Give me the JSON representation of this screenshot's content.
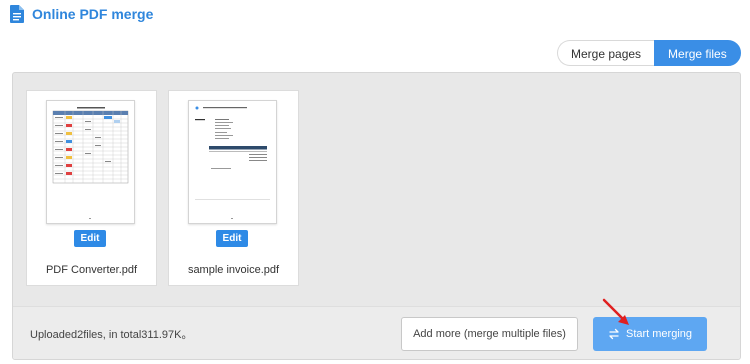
{
  "header": {
    "title": "Online PDF merge",
    "icon": "document-icon"
  },
  "mode_toggle": {
    "merge_pages": "Merge pages",
    "merge_files": "Merge files",
    "active": "merge_files"
  },
  "files": [
    {
      "name": "PDF Converter.pdf",
      "edit_label": "Edit"
    },
    {
      "name": "sample invoice.pdf",
      "edit_label": "Edit"
    }
  ],
  "footer": {
    "upload_info": "Uploaded2files, in total311.97K。",
    "add_more": "Add more (merge multiple files)",
    "start_merging": "Start merging"
  },
  "colors": {
    "accent": "#3a8ee6",
    "title": "#2f86dc",
    "start_button": "#5ea7f2",
    "annotation_arrow": "#e02020"
  }
}
